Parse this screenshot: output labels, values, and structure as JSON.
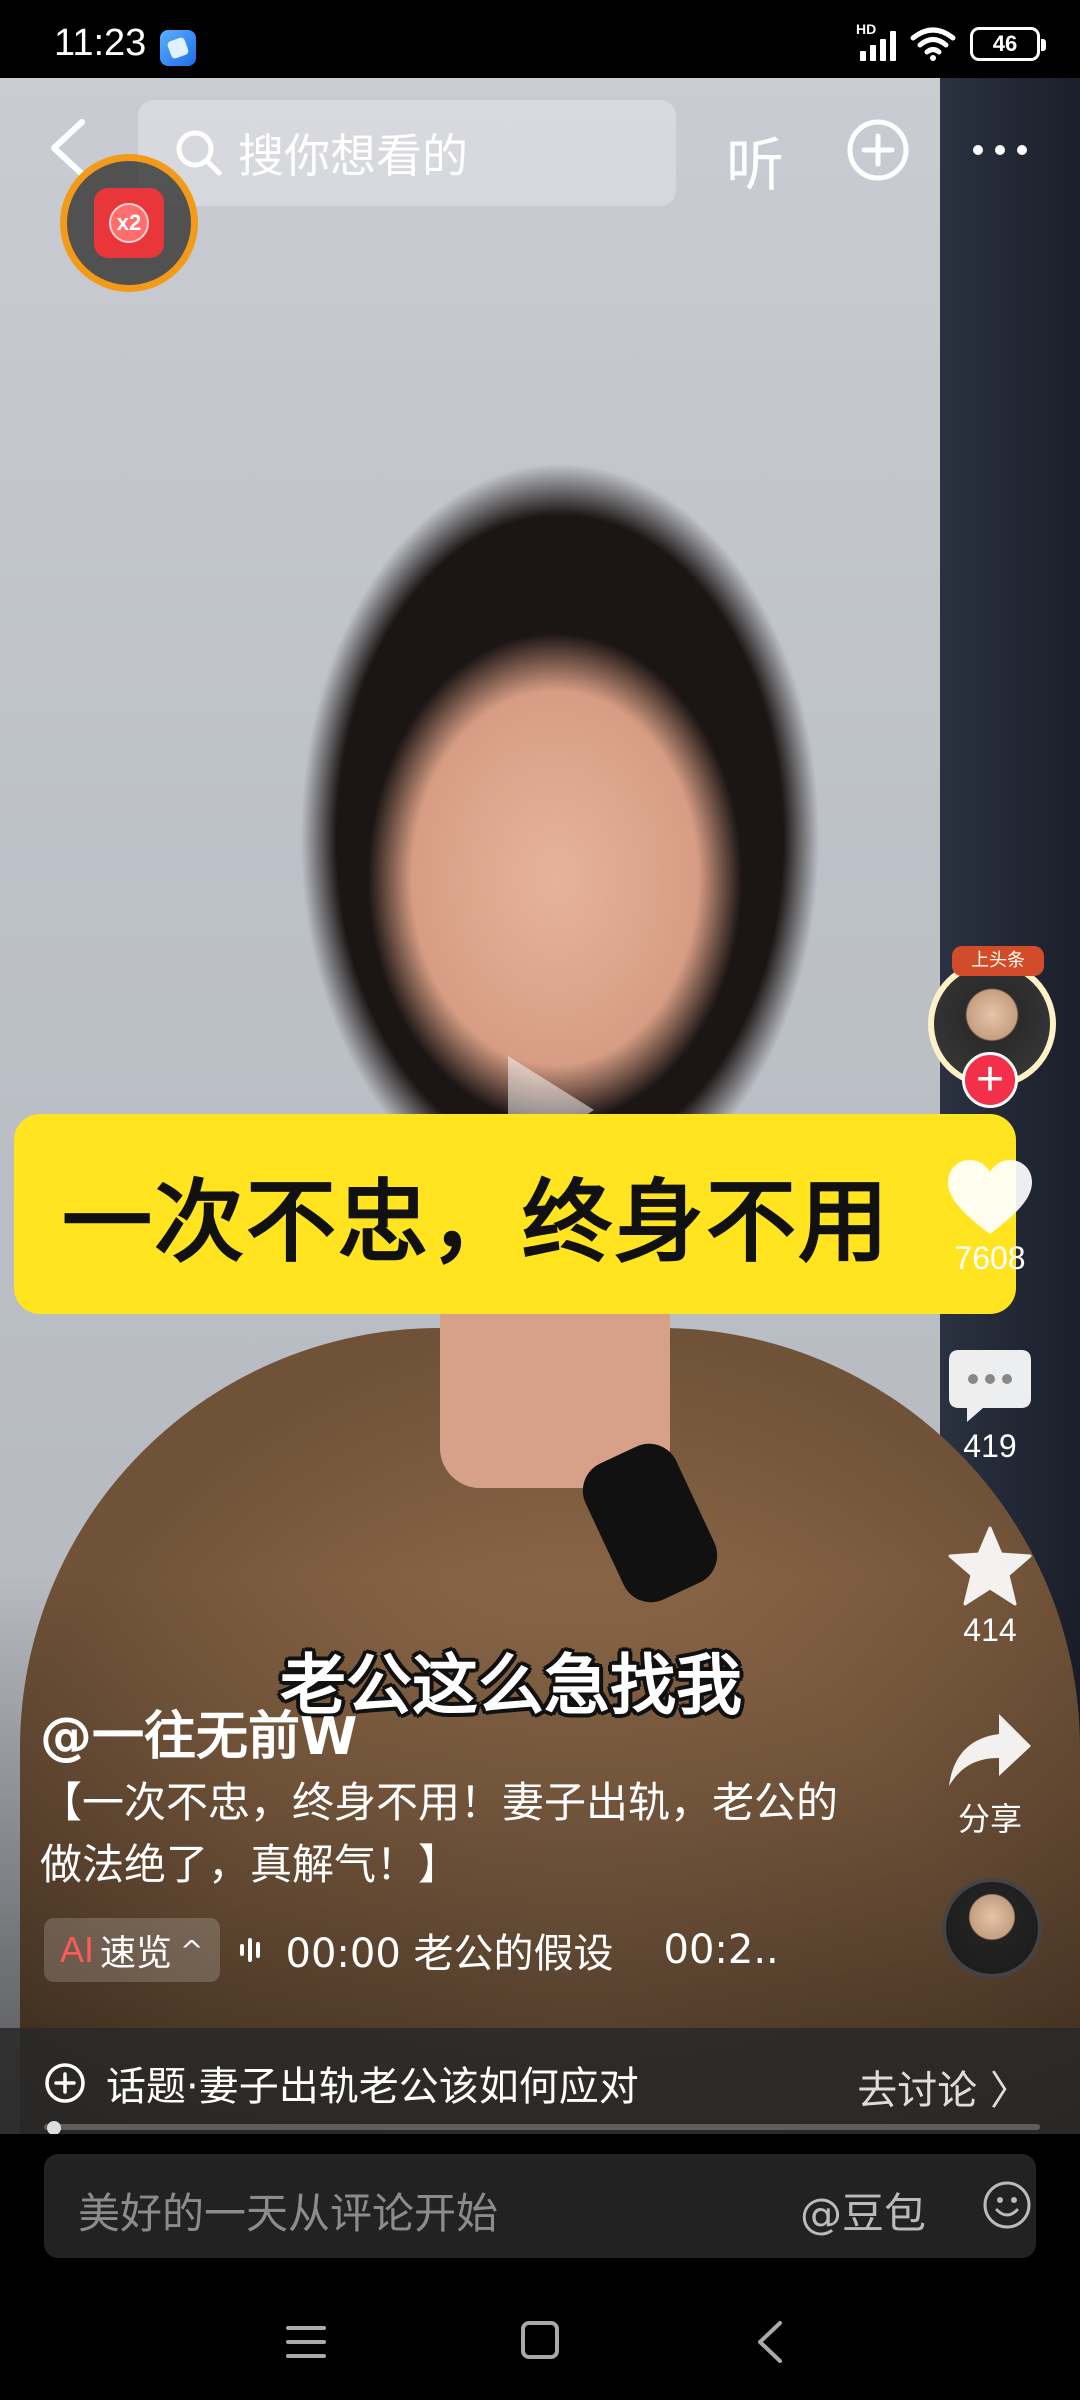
{
  "status_bar": {
    "time": "11:23",
    "network_label": "HD",
    "battery": "46"
  },
  "top_bar": {
    "search_placeholder": "搜你想看的",
    "listen_label": "听"
  },
  "reward_badge": {
    "label": "x2"
  },
  "video": {
    "banner_text": "一次不忠，终身不用",
    "subtitle": "老公这么急找我"
  },
  "author_tag": "上头条",
  "right_rail": {
    "likes": "7608",
    "comments": "419",
    "favorites": "414",
    "share_label": "分享"
  },
  "post": {
    "author": "@一往无前W",
    "description": "【一次不忠，终身不用！妻子出轨，老公的做法绝了，真解气！】"
  },
  "ai_summary": {
    "ai_label": "AI",
    "label": "速览",
    "chapter_1": "00:00 老公的假设",
    "chapter_2": "00:2.."
  },
  "topic": {
    "label": "话题·妻子出轨老公该如何应对",
    "action": "去讨论 〉"
  },
  "playback": {
    "progress": 0.01
  },
  "comment_bar": {
    "placeholder": "美好的一天从评论开始",
    "mention": "@豆包"
  },
  "colors": {
    "banner_yellow": "#ffe41f",
    "follow_red": "#f2304a",
    "reward_ring": "#f39a19"
  }
}
